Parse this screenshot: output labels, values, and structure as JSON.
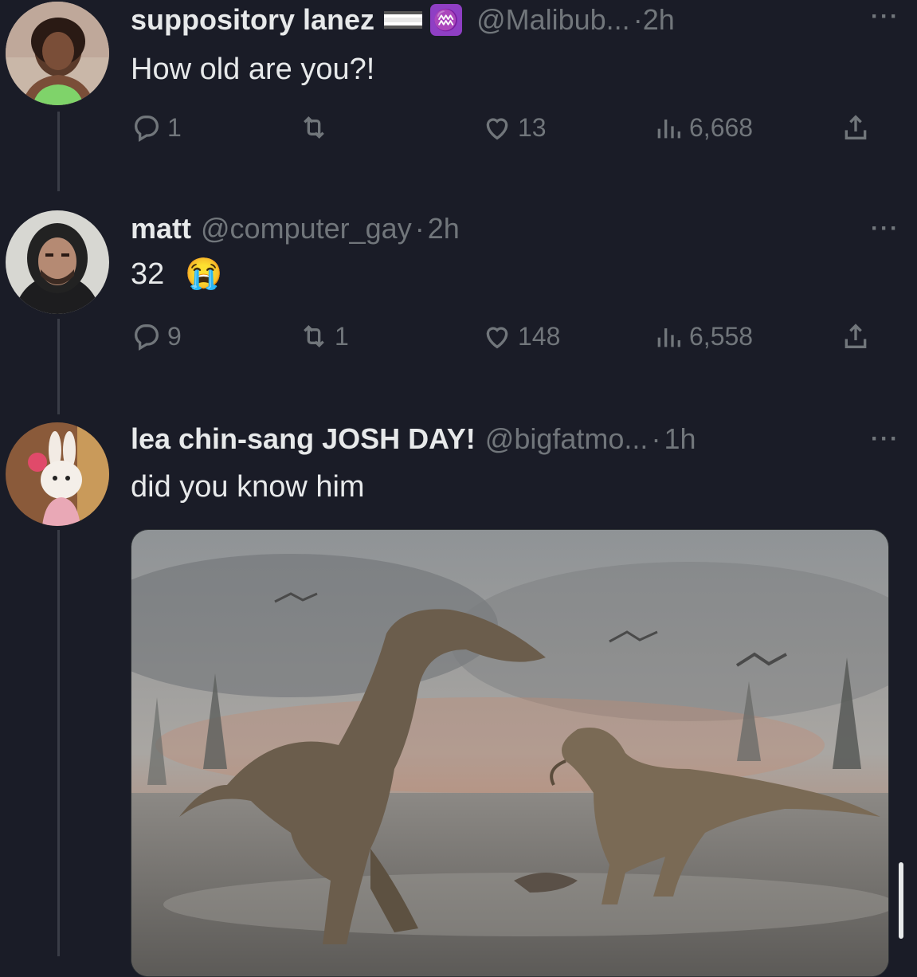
{
  "tweets": [
    {
      "name": "suppository lanez",
      "handle": "@Malibub...",
      "dot": "·",
      "time": "2h",
      "zodiac": "♒",
      "text": "How old are you?!",
      "replies": "1",
      "retweets": "",
      "likes": "13",
      "views": "6,668",
      "more": "···"
    },
    {
      "name": "matt",
      "handle": "@computer_gay",
      "dot": "·",
      "time": "2h",
      "text": "32",
      "emoji": "😭",
      "replies": "9",
      "retweets": "1",
      "likes": "148",
      "views": "6,558",
      "more": "···"
    },
    {
      "name": "lea chin-sang JOSH DAY!",
      "handle": "@bigfatmo...",
      "dot": "·",
      "time": "1h",
      "text": "did you know him",
      "more": "···"
    }
  ],
  "icons": {
    "reply": "reply-icon",
    "retweet": "retweet-icon",
    "like": "heart-icon",
    "views": "views-icon",
    "share": "share-icon"
  },
  "colors": {
    "background": "#1a1c27",
    "text": "#e7e9ea",
    "muted": "#71767b"
  }
}
